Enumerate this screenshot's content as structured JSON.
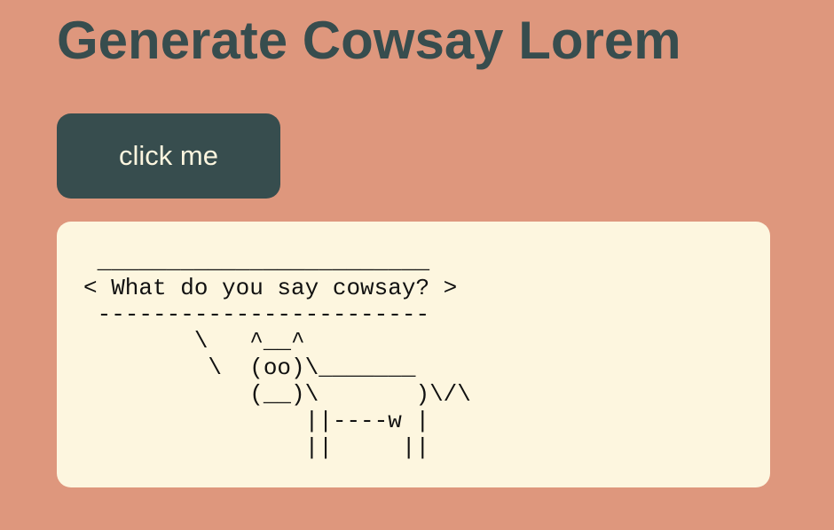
{
  "page": {
    "title": "Generate Cowsay Lorem"
  },
  "button": {
    "label": "click me"
  },
  "output": {
    "text": " ________________________\n< What do you say cowsay? >\n ------------------------\n        \\   ^__^\n         \\  (oo)\\_______\n            (__)\\       )\\/\\\n                ||----w |\n                ||     ||"
  },
  "colors": {
    "background": "#de977d",
    "title": "#374d4e",
    "button_bg": "#374d4e",
    "button_text": "#fdf6df",
    "panel_bg": "#fdf6df"
  }
}
